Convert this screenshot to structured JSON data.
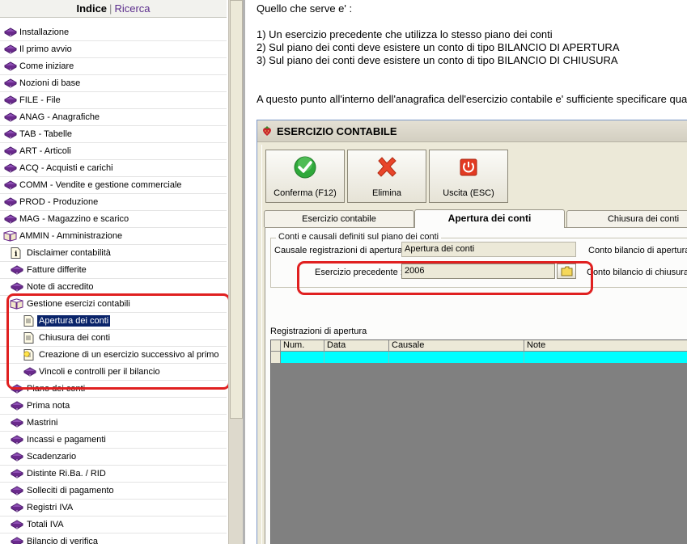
{
  "nav_tabs": {
    "index": "Indice",
    "separator": "|",
    "search": "Ricerca"
  },
  "tree": [
    {
      "label": "Installazione",
      "level": 0,
      "icon": "closed-book-icon"
    },
    {
      "label": "Il primo avvio",
      "level": 0,
      "icon": "closed-book-icon"
    },
    {
      "label": "Come iniziare",
      "level": 0,
      "icon": "closed-book-icon"
    },
    {
      "label": "Nozioni di base",
      "level": 0,
      "icon": "closed-book-icon"
    },
    {
      "label": "FILE - File",
      "level": 0,
      "icon": "closed-book-icon"
    },
    {
      "label": "ANAG - Anagrafiche",
      "level": 0,
      "icon": "closed-book-icon"
    },
    {
      "label": "TAB - Tabelle",
      "level": 0,
      "icon": "closed-book-icon"
    },
    {
      "label": "ART - Articoli",
      "level": 0,
      "icon": "closed-book-icon"
    },
    {
      "label": "ACQ -  Acquisti e carichi",
      "level": 0,
      "icon": "closed-book-icon"
    },
    {
      "label": "COMM - Vendite e gestione commerciale",
      "level": 0,
      "icon": "closed-book-icon"
    },
    {
      "label": "PROD - Produzione",
      "level": 0,
      "icon": "closed-book-icon"
    },
    {
      "label": "MAG - Magazzino e scarico",
      "level": 0,
      "icon": "closed-book-icon"
    },
    {
      "label": "AMMIN - Amministrazione",
      "level": 0,
      "icon": "open-book-icon"
    },
    {
      "label": "Disclaimer contabilità",
      "level": 1,
      "icon": "info-page-icon"
    },
    {
      "label": "Fatture differite",
      "level": 1,
      "icon": "closed-book-icon"
    },
    {
      "label": "Note di accredito",
      "level": 1,
      "icon": "closed-book-icon"
    },
    {
      "label": "Gestione esercizi contabili",
      "level": 1,
      "icon": "open-book-icon"
    },
    {
      "label": "Apertura dei conti",
      "level": 2,
      "icon": "page-icon",
      "selected": true
    },
    {
      "label": "Chiusura dei conti",
      "level": 2,
      "icon": "page-icon"
    },
    {
      "label": "Creazione di un esercizio successivo al primo",
      "level": 2,
      "icon": "tip-page-icon"
    },
    {
      "label": "Vincoli e controlli per il bilancio",
      "level": 2,
      "icon": "closed-book-icon"
    },
    {
      "label": "Piano dei conti",
      "level": 1,
      "icon": "closed-book-icon"
    },
    {
      "label": "Prima nota",
      "level": 1,
      "icon": "closed-book-icon"
    },
    {
      "label": "Mastrini",
      "level": 1,
      "icon": "closed-book-icon"
    },
    {
      "label": "Incassi e pagamenti",
      "level": 1,
      "icon": "closed-book-icon"
    },
    {
      "label": "Scadenzario",
      "level": 1,
      "icon": "closed-book-icon"
    },
    {
      "label": "Distinte Ri.Ba. / RID",
      "level": 1,
      "icon": "closed-book-icon"
    },
    {
      "label": "Solleciti di pagamento",
      "level": 1,
      "icon": "closed-book-icon"
    },
    {
      "label": "Registri IVA",
      "level": 1,
      "icon": "closed-book-icon"
    },
    {
      "label": "Totali IVA",
      "level": 1,
      "icon": "closed-book-icon"
    },
    {
      "label": "Bilancio di verifica",
      "level": 1,
      "icon": "closed-book-icon"
    }
  ],
  "content": {
    "intro": "Quello che serve e' :",
    "items": [
      "1) Un esercizio precedente che utilizza lo stesso piano dei conti",
      "2) Sul piano dei conti deve esistere un conto di tipo BILANCIO DI APERTURA",
      "3) Sul piano dei conti deve esistere un conto di tipo BILANCIO DI CHIUSURA"
    ],
    "paragraph": "A questo punto all'interno dell'anagrafica dell'esercizio contabile e' sufficiente specificare qua"
  },
  "dialog": {
    "title": "ESERCIZIO CONTABILE",
    "buttons": {
      "confirm": "Conferma (F12)",
      "delete": "Elimina",
      "exit": "Uscita (ESC)"
    },
    "tabs": {
      "esercizio": "Esercizio contabile",
      "apertura": "Apertura dei conti",
      "chiusura": "Chiusura dei conti"
    },
    "group_title": "Conti e causali definiti sul piano dei conti",
    "causale_label": "Causale registrazioni di apertura :",
    "causale_value": "Apertura dei conti",
    "conto_apertura_label": "Conto bilancio di apertura",
    "esercizio_prec_label": "Esercizio precedente :",
    "esercizio_prec_value": "2006",
    "conto_chiusura_label": "Conto bilancio di chiusura",
    "registrazioni_label": "Registrazioni di apertura",
    "grid_columns": [
      "Num.",
      "Data",
      "Causale",
      "Note"
    ]
  },
  "colors": {
    "highlight": "#e02020",
    "selection": "#0a246a",
    "grid_row": "#00ffff",
    "book_icon": "#6a2a8c"
  }
}
